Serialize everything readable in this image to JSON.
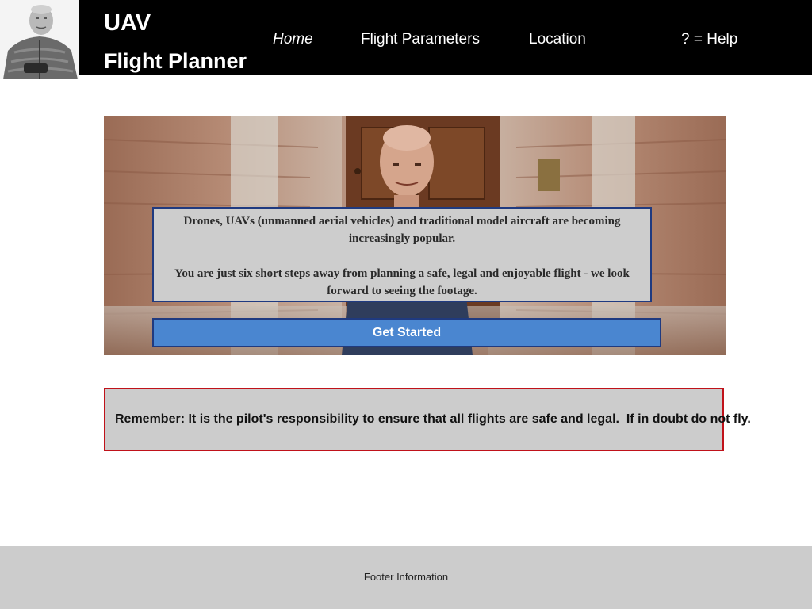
{
  "header": {
    "title_line1": "UAV",
    "title_line2": "Flight Planner",
    "avatar_icon": "pilot-portrait",
    "nav": [
      {
        "label": "Home",
        "active": true
      },
      {
        "label": "Flight Parameters",
        "active": false
      },
      {
        "label": "Location",
        "active": false
      },
      {
        "label": "? = Help",
        "active": false
      }
    ]
  },
  "hero": {
    "image_icon": "pilot-photo",
    "intro_paragraph1": "Drones, UAVs (unmanned aerial vehicles) and traditional model aircraft are becoming increasingly popular.",
    "intro_paragraph2": "You are just six short steps away from planning a safe, legal and enjoyable flight - we look forward to seeing the footage.",
    "button_label": "Get Started"
  },
  "warning": {
    "text": "Remember: It is the pilot's responsibility to ensure that all flights are safe and legal.  If in doubt do not fly."
  },
  "footer": {
    "text": "Footer Information"
  },
  "colors": {
    "header_bg": "#000000",
    "button_bg": "#4a86d0",
    "box_border": "#1f3a80",
    "warning_border": "#c0121a",
    "panel_bg": "#cccccc"
  }
}
